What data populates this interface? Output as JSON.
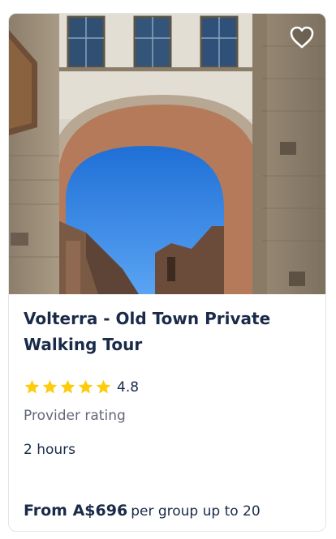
{
  "card": {
    "title": "Volterra - Old Town Private Walking Tour",
    "rating_value": "4.8",
    "rating_stars": 5,
    "rating_label": "Provider rating",
    "duration": "2 hours",
    "price": "From A$696",
    "price_unit": "per group up to 20",
    "wishlist_icon": "heart-outline-icon",
    "image_icon": "stone-archway-photo"
  },
  "colors": {
    "title": "#1a2b49",
    "star": "#fdcc0d",
    "muted": "#63687a",
    "border": "#e2e4e8"
  }
}
